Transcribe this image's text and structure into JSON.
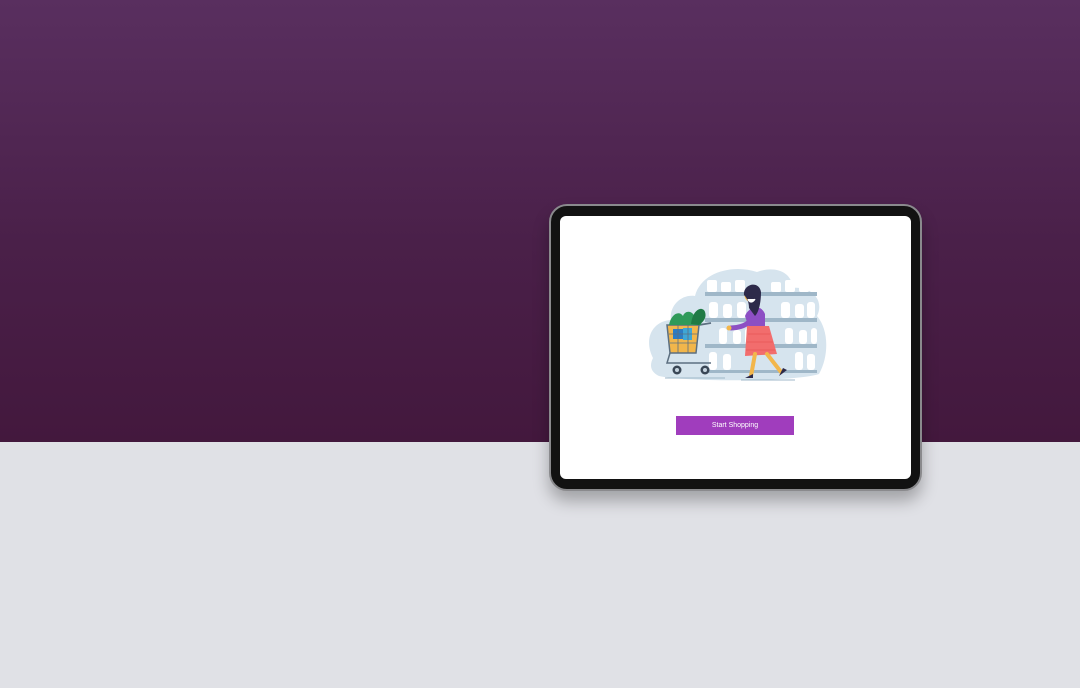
{
  "colors": {
    "top_band": "#592f5f",
    "floor": "#e0e1e6",
    "tablet_frame": "#121212",
    "screen": "#ffffff",
    "button": "#a03dbd",
    "button_text": "#ffffff"
  },
  "device": {
    "type": "tablet"
  },
  "illustration": {
    "icon": "woman-pushing-shopping-cart-illustration"
  },
  "cta": {
    "label": "Start Shopping"
  }
}
